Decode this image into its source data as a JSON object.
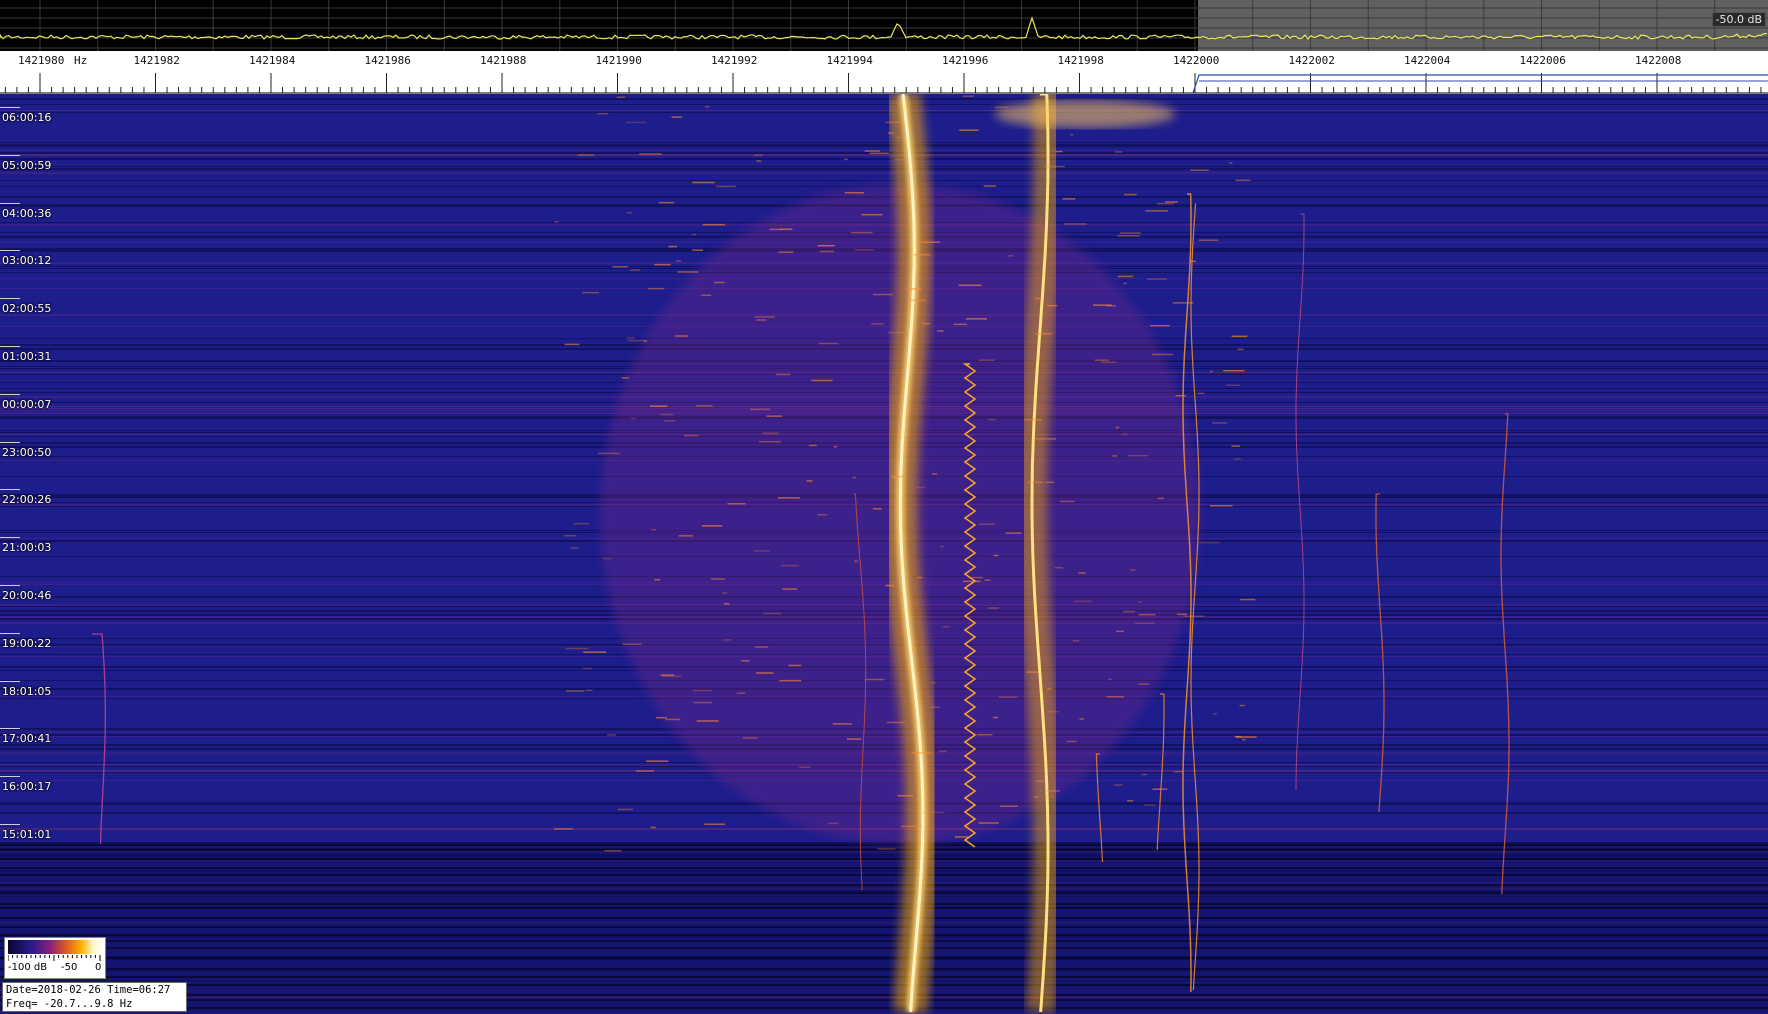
{
  "spectrum": {
    "level_readout": "-50.0 dB"
  },
  "frequency_axis": {
    "unit_label": "Hz",
    "labels": [
      "1421980",
      "1421982",
      "1421984",
      "1421986",
      "1421988",
      "1421990",
      "1421992",
      "1421994",
      "1421996",
      "1421998",
      "1422000",
      "1422002",
      "1422004",
      "1422006",
      "1422008"
    ]
  },
  "time_axis": {
    "labels": [
      "06:00:16",
      "05:00:59",
      "04:00:36",
      "03:00:12",
      "02:00:55",
      "01:00:31",
      "00:00:07",
      "23:00:50",
      "22:00:26",
      "21:00:03",
      "20:00:46",
      "19:00:22",
      "18:01:05",
      "17:00:41",
      "16:00:17",
      "15:01:01"
    ]
  },
  "legend": {
    "min_label": "-100 dB",
    "mid_label": "-50",
    "max_label": "0"
  },
  "info": {
    "date_line": "Date=2018-02-26 Time=06:27",
    "freq_line": "Freq= -20.7...9.8 Hz"
  },
  "colors": {
    "waterfall_bg": "#1d1d8c",
    "trace": "#e8e85a",
    "signal_core": "#fff4c0",
    "signal_glow": "#ffb000"
  }
}
